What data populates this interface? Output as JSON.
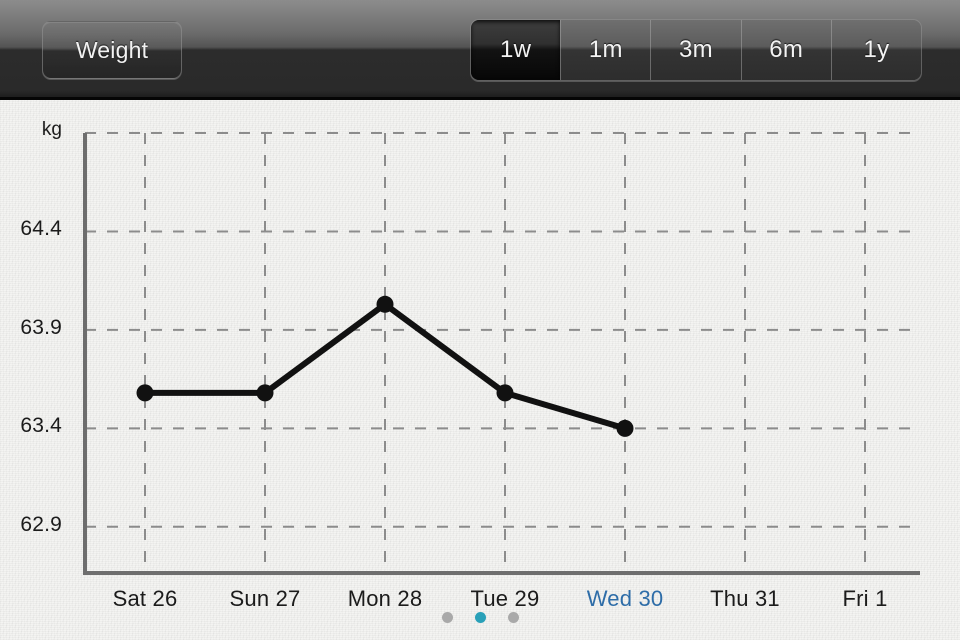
{
  "header": {
    "metric_button_label": "Weight",
    "ranges": [
      {
        "label": "1w",
        "selected": true
      },
      {
        "label": "1m",
        "selected": false
      },
      {
        "label": "3m",
        "selected": false
      },
      {
        "label": "6m",
        "selected": false
      },
      {
        "label": "1y",
        "selected": false
      }
    ]
  },
  "pagination": {
    "dots": [
      {
        "active": false
      },
      {
        "active": true
      },
      {
        "active": false
      }
    ]
  },
  "colors": {
    "today_label": "#2e6da8",
    "active_dot": "#29a0b8",
    "inactive_dot": "#a9a9a9",
    "line": "#111111",
    "gridline": "#8c8c8c",
    "axis": "#6e6e6e",
    "background": "#f4f4f2",
    "header_dark": "#2a2a2a"
  },
  "chart_data": {
    "type": "line",
    "title": "Weight",
    "xlabel": "",
    "ylabel": "kg",
    "unit_label": "kg",
    "categories": [
      "Sat 26",
      "Sun 27",
      "Mon 28",
      "Tue 29",
      "Wed 30",
      "Thu 31",
      "Fri 1"
    ],
    "highlighted_category": "Wed 30",
    "series": [
      {
        "name": "Weight",
        "values": [
          63.58,
          63.58,
          64.03,
          63.58,
          63.4,
          null,
          null
        ]
      }
    ],
    "ytick_labels": [
      "64.4",
      "63.9",
      "63.4",
      "62.9"
    ],
    "yticks": [
      64.4,
      63.9,
      63.4,
      62.9
    ],
    "ylim": [
      62.64,
      64.9
    ],
    "grid": true,
    "grid_style": "dashed",
    "legend": "none",
    "markers": true
  }
}
